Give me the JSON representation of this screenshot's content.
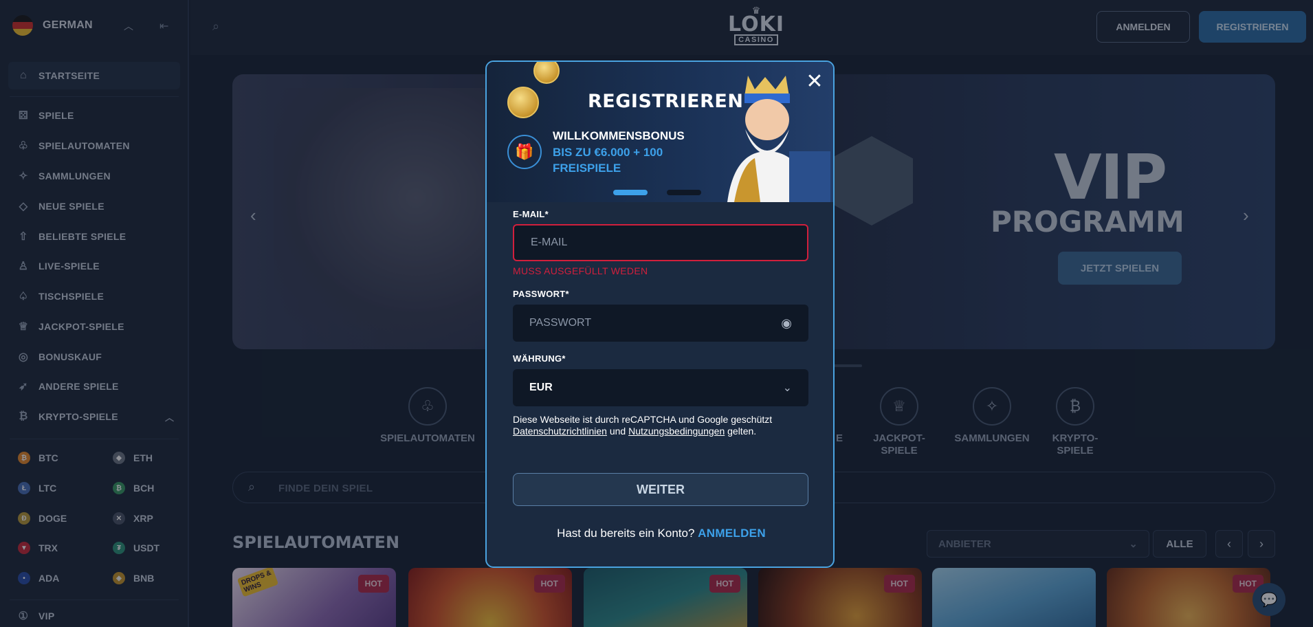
{
  "sidebar": {
    "language": "GERMAN",
    "items": [
      {
        "label": "STARTSEITE",
        "icon": "home-icon"
      },
      {
        "label": "SPIELE",
        "icon": "dice-icon"
      },
      {
        "label": "SPIELAUTOMATEN",
        "icon": "cherries-icon"
      },
      {
        "label": "SAMMLUNGEN",
        "icon": "sparkles-icon"
      },
      {
        "label": "NEUE SPIELE",
        "icon": "diamond-icon"
      },
      {
        "label": "BELIEBTE SPIELE",
        "icon": "arrow-up-icon"
      },
      {
        "label": "LIVE-SPIELE",
        "icon": "dealer-icon"
      },
      {
        "label": "TISCHSPIELE",
        "icon": "spade-icon"
      },
      {
        "label": "JACKPOT-SPIELE",
        "icon": "crown-icon"
      },
      {
        "label": "BONUSKAUF",
        "icon": "target-icon"
      },
      {
        "label": "ANDERE SPIELE",
        "icon": "rocket-icon"
      },
      {
        "label": "KRYPTO-SPIELE",
        "icon": "bitcoin-icon"
      }
    ],
    "crypto": [
      {
        "label": "BTC",
        "color": "#e5892a"
      },
      {
        "label": "ETH",
        "color": "#6d7784"
      },
      {
        "label": "LTC",
        "color": "#4a6fb5"
      },
      {
        "label": "BCH",
        "color": "#3a9a63"
      },
      {
        "label": "DOGE",
        "color": "#b89a3a"
      },
      {
        "label": "XRP",
        "color": "#4b5566"
      },
      {
        "label": "TRX",
        "color": "#c62a3a"
      },
      {
        "label": "USDT",
        "color": "#2e9478"
      },
      {
        "label": "ADA",
        "color": "#2a4fa8"
      },
      {
        "label": "BNB",
        "color": "#c7962a"
      }
    ],
    "vip": "VIP"
  },
  "header": {
    "logo_main": "LOKI",
    "logo_sub": "CASINO",
    "login": "ANMELDEN",
    "register": "REGISTRIEREN"
  },
  "hero": {
    "title": "VIP",
    "subtitle": "PROGRAMM",
    "button": "JETZT SPIELEN"
  },
  "categories": [
    {
      "label": "SPIELAUTOMATEN",
      "icon": "cherries-icon"
    },
    {
      "label": "E",
      "icon": ""
    },
    {
      "label": "JACKPOT-\nSPIELE",
      "icon": "crown-icon"
    },
    {
      "label": "SAMMLUNGEN",
      "icon": "sparkles-icon"
    },
    {
      "label": "KRYPTO-\nSPIELE",
      "icon": "bitcoin-icon"
    }
  ],
  "game_search": {
    "placeholder": "FINDE DEIN SPIEL"
  },
  "section": {
    "title": "SPIELAUTOMATEN",
    "provider": "ANBIETER",
    "all": "ALLE"
  },
  "games": [
    {
      "badge": "HOT",
      "promo": "DROPS & WINS"
    },
    {
      "badge": "HOT"
    },
    {
      "badge": "HOT"
    },
    {
      "badge": "HOT"
    },
    {
      "badge": ""
    },
    {
      "badge": "HOT"
    }
  ],
  "modal": {
    "title": "REGISTRIEREN",
    "bonus_title": "WILLKOMMENSBONUS",
    "bonus_amount": "BIS ZU €6.000 + 100 FREISPIELE",
    "email_label": "E-MAIL*",
    "email_placeholder": "E-MAIL",
    "email_error": "MUSS AUSGEFÜLLT WEDEN",
    "password_label": "PASSWORT*",
    "password_placeholder": "PASSWORT",
    "currency_label": "WÄHRUNG*",
    "currency_value": "EUR",
    "recaptcha_prefix": "Diese Webseite ist durch reCAPTCHA und Google geschützt",
    "privacy_link": "Datenschutzrichtlinien",
    "and": "und",
    "terms_link": "Nutzungsbedingungen",
    "recaptcha_suffix": "gelten.",
    "continue": "WEITER",
    "have_account": "Hast du bereits ein Konto?",
    "login_link": "ANMELDEN"
  },
  "colors": {
    "accent": "#3da1ea",
    "error": "#d21f3c",
    "hot_badge": "#b02a4a"
  }
}
